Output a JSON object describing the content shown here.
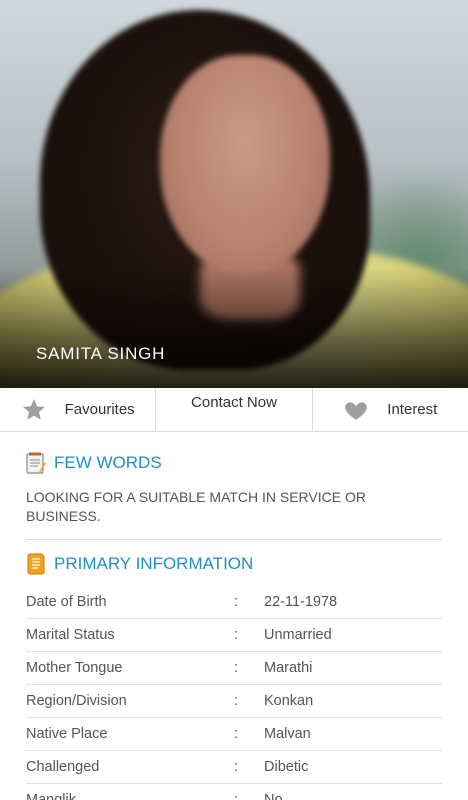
{
  "profile": {
    "name": "SAMITA SINGH"
  },
  "actions": {
    "favourites": "Favourites",
    "contact": "Contact Now",
    "interest": "Interest"
  },
  "few_words": {
    "title": "FEW WORDS",
    "text": "LOOKING FOR A SUITABLE MATCH IN SERVICE OR BUSINESS."
  },
  "primary": {
    "title": "PRIMARY INFORMATION",
    "separator": ":",
    "rows": [
      {
        "label": "Date of Birth",
        "value": "22-11-1978"
      },
      {
        "label": "Marital Status",
        "value": "Unmarried"
      },
      {
        "label": "Mother Tongue",
        "value": "Marathi"
      },
      {
        "label": "Region/Division",
        "value": "Konkan"
      },
      {
        "label": "Native Place",
        "value": "Malvan"
      },
      {
        "label": "Challenged",
        "value": "Dibetic"
      },
      {
        "label": "Manglik",
        "value": "No"
      }
    ]
  },
  "colors": {
    "accent": "#1e8fc6",
    "icon_gray": "#9e9e9e"
  }
}
